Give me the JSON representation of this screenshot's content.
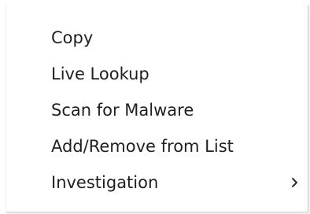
{
  "context_menu": {
    "items": [
      {
        "label": "Copy",
        "has_submenu": false
      },
      {
        "label": "Live Lookup",
        "has_submenu": false
      },
      {
        "label": "Scan for Malware",
        "has_submenu": false
      },
      {
        "label": "Add/Remove from List",
        "has_submenu": false
      },
      {
        "label": "Investigation",
        "has_submenu": true,
        "submenu_icon": "chevron-right-icon"
      }
    ]
  }
}
